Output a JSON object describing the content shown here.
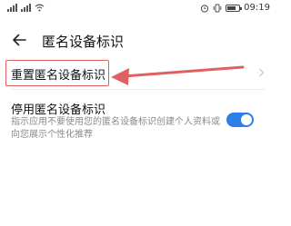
{
  "status_bar": {
    "time": "09:19",
    "icons": [
      "signal-icon",
      "signal-icon",
      "wifi-icon",
      "alarm-icon",
      "vibrate-icon",
      "battery-icon"
    ]
  },
  "header": {
    "title": "匿名设备标识",
    "back_icon": "back-arrow-icon"
  },
  "settings": {
    "reset_label": "重置匿名设备标识",
    "disable_label": "停用匿名设备标识",
    "disable_desc": "指示应用不要使用您的匿名设备标识创建个人资料或向您展示个性化推荐",
    "disable_enabled": true
  },
  "colors": {
    "accent": "#2b80e8",
    "annotation": "#e06060"
  }
}
